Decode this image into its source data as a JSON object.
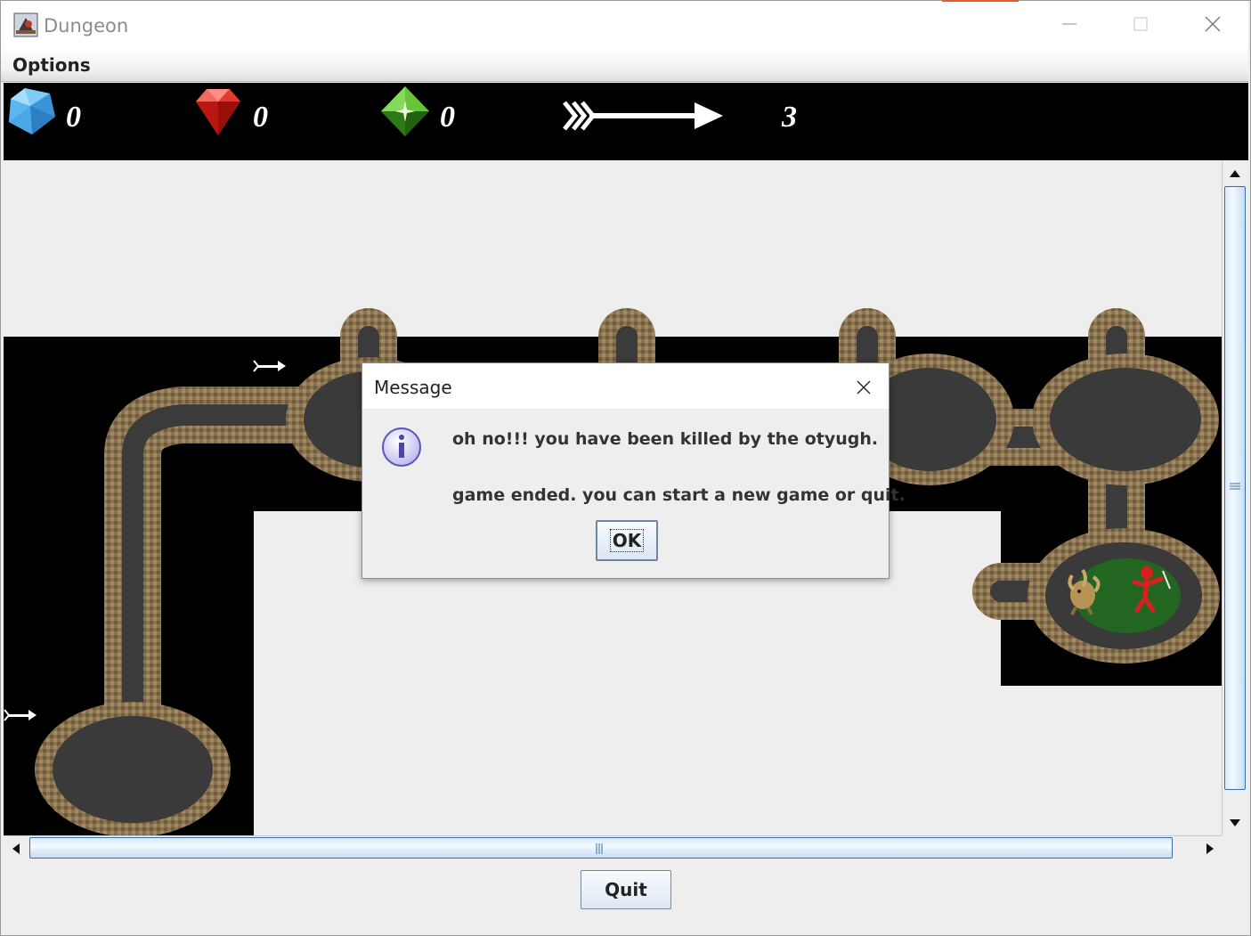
{
  "window": {
    "title": "Dungeon"
  },
  "menu": {
    "options_label": "Options"
  },
  "inventory": {
    "diamonds": "0",
    "rubies": "0",
    "sapphires": "0",
    "arrows": "3"
  },
  "dialog": {
    "title": "Message",
    "line1": "oh no!!! you have been killed by the otyugh.",
    "line2": "game ended. you can start a new game or quit.",
    "ok_label": "OK"
  },
  "footer": {
    "quit_label": "Quit"
  },
  "colors": {
    "accent": "#e8592c",
    "scroll_thumb_border": "#3a6ea5",
    "diamond": "#4aa7e8",
    "ruby": "#d8231c",
    "sapphire": "#3a9a1e"
  },
  "icons": [
    "app-icon",
    "minimize-icon",
    "maximize-icon",
    "close-icon",
    "diamond-icon",
    "ruby-icon",
    "sapphire-icon",
    "arrow-icon",
    "info-icon",
    "otyugh-icon",
    "player-icon"
  ]
}
